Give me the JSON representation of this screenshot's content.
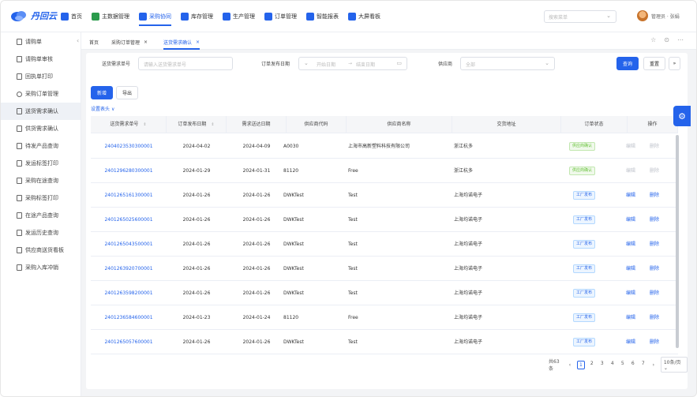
{
  "app": {
    "logo_text": "丹回云"
  },
  "nav": [
    {
      "label": "首页",
      "icon": "home-icon",
      "color": "#2463eb"
    },
    {
      "label": "主数据管理",
      "icon": "database-icon",
      "color": "#2b9b4c"
    },
    {
      "label": "采购协同",
      "icon": "cart-icon",
      "color": "#2463eb",
      "active": true
    },
    {
      "label": "库存管理",
      "icon": "warehouse-icon",
      "color": "#2463eb"
    },
    {
      "label": "生产管理",
      "icon": "factory-icon",
      "color": "#2463eb"
    },
    {
      "label": "订单管理",
      "icon": "order-icon",
      "color": "#2463eb"
    },
    {
      "label": "智能报表",
      "icon": "report-icon",
      "color": "#2463eb"
    },
    {
      "label": "大屏看板",
      "icon": "dashboard-icon",
      "color": "#2463eb"
    }
  ],
  "top_search": {
    "placeholder": "搜索菜单"
  },
  "user": {
    "name": "管理员 · 张娟"
  },
  "sidebar": [
    {
      "label": "请购单"
    },
    {
      "label": "请购单审核"
    },
    {
      "label": "回执单打印"
    },
    {
      "label": "采购订单管理"
    },
    {
      "label": "送货需求确认",
      "active": true
    },
    {
      "label": "供货需求确认"
    },
    {
      "label": "待发产品查询"
    },
    {
      "label": "发运标签打印"
    },
    {
      "label": "采购在途查询"
    },
    {
      "label": "采购标签打印"
    },
    {
      "label": "在途产品查询"
    },
    {
      "label": "发运历史查询"
    },
    {
      "label": "供应商送货看板"
    },
    {
      "label": "采购入库冲销"
    }
  ],
  "tabs": [
    {
      "label": "首页"
    },
    {
      "label": "采购订单管理"
    },
    {
      "label": "送货需求确认",
      "active": true
    }
  ],
  "filters": {
    "req_no_label": "送货需求单号",
    "req_no_placeholder": "请输入送货需求单号",
    "date_label": "订单发布日期",
    "date_start": "开始日期",
    "date_sep": "→",
    "date_end": "结束日期",
    "supplier_label": "供应商",
    "supplier_value": "全部",
    "query": "查询",
    "reset": "重置"
  },
  "actions": {
    "add": "新增",
    "export": "导出",
    "settings": "设置表头"
  },
  "table": {
    "headers": [
      "送货需求单号",
      "订单发布日期",
      "需求送达日期",
      "供应商代码",
      "供应商名称",
      "交货地址",
      "订单状态",
      "操作"
    ],
    "rows": [
      {
        "no": "2404023530300001",
        "pub": "2024-04-02",
        "req": "2024-04-09",
        "code": "A0030",
        "name": "上海市高新塑料科技有限公司",
        "addr": "浙江杭多",
        "status": "供应商确认",
        "status_type": "green",
        "edit": "编辑",
        "del": "删除",
        "ops_enabled": false
      },
      {
        "no": "2401296280300001",
        "pub": "2024-01-29",
        "req": "2024-01-31",
        "code": "81120",
        "name": "Free",
        "addr": "浙江杭多",
        "status": "供应商确认",
        "status_type": "green",
        "edit": "编辑",
        "del": "删除",
        "ops_enabled": false
      },
      {
        "no": "2401265161300001",
        "pub": "2024-01-26",
        "req": "2024-01-26",
        "code": "DWKTest",
        "name": "Test",
        "addr": "上海均诺电子",
        "status": "工厂发布",
        "status_type": "blue",
        "edit": "编辑",
        "del": "删除",
        "ops_enabled": true
      },
      {
        "no": "2401265025600001",
        "pub": "2024-01-26",
        "req": "2024-01-26",
        "code": "DWKTest",
        "name": "Test",
        "addr": "上海均诺电子",
        "status": "工厂发布",
        "status_type": "blue",
        "edit": "编辑",
        "del": "删除",
        "ops_enabled": true
      },
      {
        "no": "2401265043500001",
        "pub": "2024-01-26",
        "req": "2024-01-26",
        "code": "DWKTest",
        "name": "Test",
        "addr": "上海均诺电子",
        "status": "工厂发布",
        "status_type": "blue",
        "edit": "编辑",
        "del": "删除",
        "ops_enabled": true
      },
      {
        "no": "2401263920700001",
        "pub": "2024-01-26",
        "req": "2024-01-26",
        "code": "DWKTest",
        "name": "Test",
        "addr": "上海均诺电子",
        "status": "工厂发布",
        "status_type": "blue",
        "edit": "编辑",
        "del": "删除",
        "ops_enabled": true
      },
      {
        "no": "2401263598200001",
        "pub": "2024-01-26",
        "req": "2024-01-26",
        "code": "DWKTest",
        "name": "Test",
        "addr": "上海均诺电子",
        "status": "工厂发布",
        "status_type": "blue",
        "edit": "编辑",
        "del": "删除",
        "ops_enabled": true
      },
      {
        "no": "2401236584600001",
        "pub": "2024-01-23",
        "req": "2024-01-24",
        "code": "81120",
        "name": "Free",
        "addr": "上海均诺电子",
        "status": "工厂发布",
        "status_type": "blue",
        "edit": "编辑",
        "del": "删除",
        "ops_enabled": true
      },
      {
        "no": "2401265057600001",
        "pub": "2024-01-26",
        "req": "2024-01-26",
        "code": "DWKTest",
        "name": "Test",
        "addr": "上海均诺电子",
        "status": "工厂发布",
        "status_type": "blue",
        "edit": "编辑",
        "del": "删除",
        "ops_enabled": true
      }
    ]
  },
  "pagination": {
    "total": "共63条",
    "pages": [
      "1",
      "2",
      "3",
      "4",
      "5",
      "6",
      "7"
    ],
    "current": "1",
    "page_size": "10条/页"
  }
}
